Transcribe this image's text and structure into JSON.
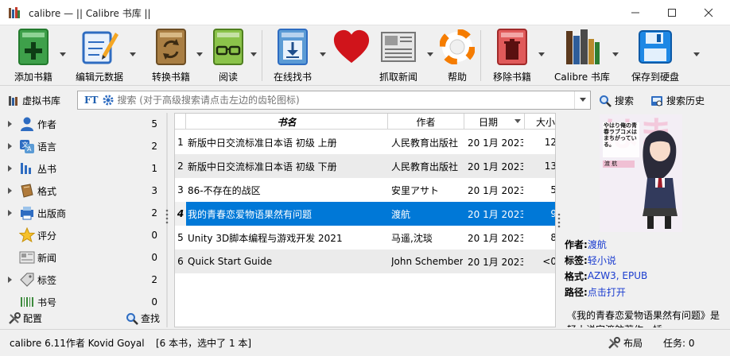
{
  "window": {
    "title": "calibre — || Calibre 书库 ||"
  },
  "toolbar": {
    "add": "添加书籍",
    "edit": "编辑元数据",
    "convert": "转换书籍",
    "read": "阅读",
    "store": "在线找书",
    "news": "抓取新闻",
    "help": "帮助",
    "remove": "移除书籍",
    "library": "Calibre 书库",
    "save": "保存到硬盘"
  },
  "search": {
    "vlib": "虚拟书库",
    "placeholder": "搜索 (对于高级搜索请点击左边的齿轮图标)",
    "search_btn": "搜索",
    "history_btn": "搜索历史",
    "ft": "FT"
  },
  "tags": [
    {
      "label": "作者",
      "count": "5",
      "expand": true
    },
    {
      "label": "语言",
      "count": "2",
      "expand": true
    },
    {
      "label": "丛书",
      "count": "1",
      "expand": true
    },
    {
      "label": "格式",
      "count": "3",
      "expand": true
    },
    {
      "label": "出版商",
      "count": "2",
      "expand": true
    },
    {
      "label": "评分",
      "count": "0",
      "expand": false
    },
    {
      "label": "新闻",
      "count": "0",
      "expand": false
    },
    {
      "label": "标签",
      "count": "2",
      "expand": true
    },
    {
      "label": "书号",
      "count": "0",
      "expand": false
    }
  ],
  "left_bottom": {
    "config": "配置",
    "find": "查找"
  },
  "table": {
    "headers": {
      "title": "书名",
      "author": "作者",
      "date": "日期",
      "size": "大小"
    },
    "rows": [
      {
        "num": "1",
        "title": "新版中日交流标准日本语 初级 上册",
        "author": "人民教育出版社",
        "date": "20 1月 2023",
        "size": "12"
      },
      {
        "num": "2",
        "title": "新版中日交流标准日本语 初级 下册",
        "author": "人民教育出版社",
        "date": "20 1月 2023",
        "size": "13"
      },
      {
        "num": "3",
        "title": "86-不存在的战区",
        "author": "安里アサト",
        "date": "20 1月 2023",
        "size": "5"
      },
      {
        "num": "4",
        "title": "我的青春恋爱物语果然有问题",
        "author": "渡航",
        "date": "20 1月 2023",
        "size": "9"
      },
      {
        "num": "5",
        "title": "Unity 3D脚本编程与游戏开发 2021",
        "author": "马遥,沈琰",
        "date": "20 1月 2023",
        "size": "8"
      },
      {
        "num": "6",
        "title": "Quick Start Guide",
        "author": "John Schember",
        "date": "20 1月 2023",
        "size": "<0"
      }
    ]
  },
  "details": {
    "author_label": "作者:",
    "author": "渡航",
    "tags_label": "标签:",
    "tags": "轻小说",
    "formats_label": "格式:",
    "formats": "AZW3, EPUB",
    "path_label": "路径:",
    "path": "点击打开",
    "comment": "《我的青春恋爱物语果然有问题》是轻小说家渡航著作，插"
  },
  "cover": {
    "text": "やはり俺の青春ラブコメはまちがっている。",
    "author_text": "渡 航"
  },
  "status": {
    "version": "calibre 6.11作者 Kovid Goyal",
    "count": "[6 本书，选中了 1 本]",
    "layout": "布局",
    "jobs": "任务: 0"
  },
  "colors": {
    "selection": "#0078d7",
    "link": "#1a3ccf"
  }
}
